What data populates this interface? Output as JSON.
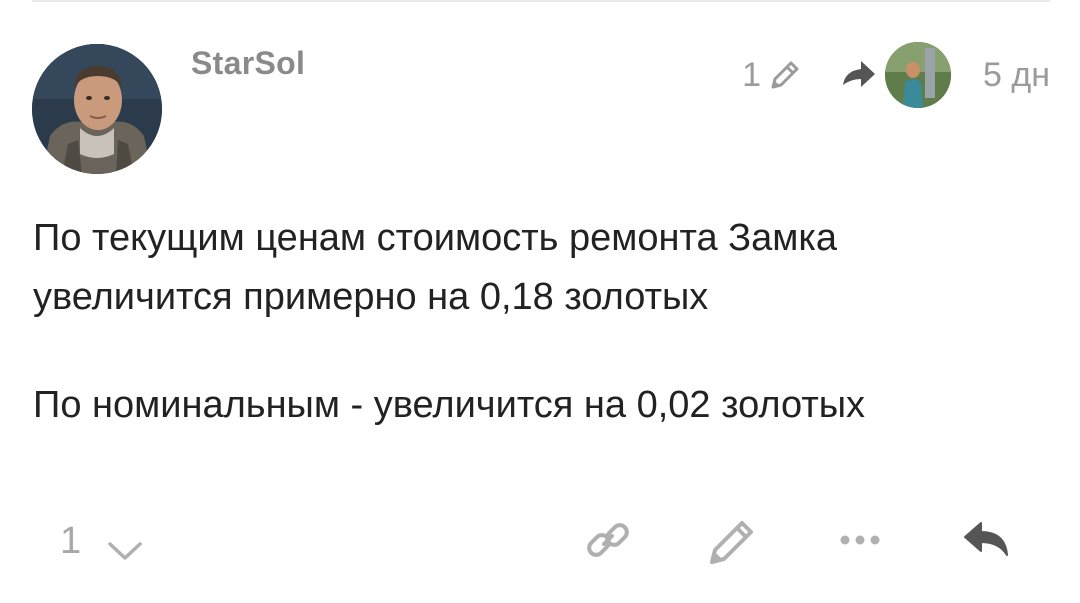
{
  "post": {
    "username": "StarSol",
    "edit_count": "1",
    "age": "5 дн",
    "paragraphs": [
      "По текущим ценам стоимость ремонта Замка увеличится примерно на 0,18 золотых",
      "По номинальным - увеличится на 0,02 золотых"
    ]
  },
  "actions": {
    "like_count": "1"
  },
  "icons": {
    "edit": "pencil-icon",
    "reply_to": "reply-arrow-icon",
    "like_toggle": "chevron-down-icon",
    "link": "link-icon",
    "edit_post": "pencil-icon",
    "more": "ellipsis-icon",
    "reply": "reply-icon"
  },
  "colors": {
    "muted_text": "#9b9b9b",
    "body_text": "#222222",
    "icon_gray": "#b0b0b0",
    "icon_dark": "#555555"
  }
}
